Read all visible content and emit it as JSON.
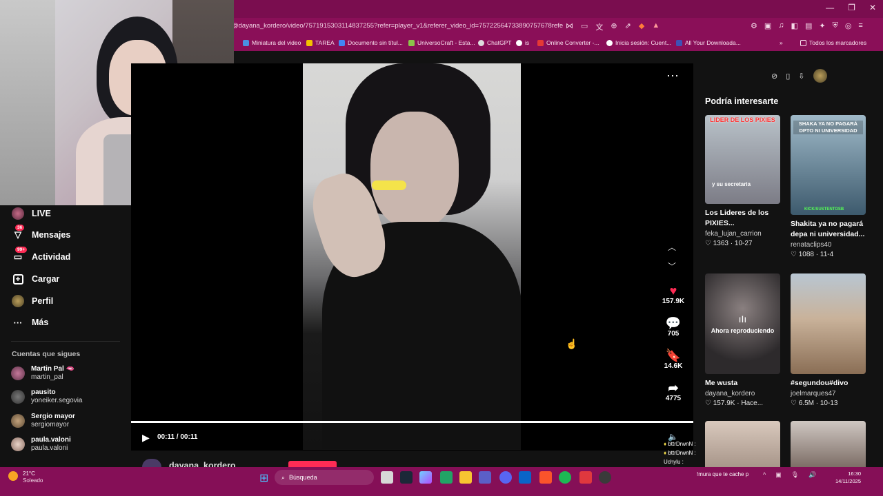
{
  "browser": {
    "url": "@dayana_kordero/video/7571915303114837255?refer=player_v1&referer_video_id=75722564733890757678referre...",
    "bookmarks": [
      "Miniatura del video",
      "TAREA",
      "Documento sin títul...",
      "UniversoCraft - Esta...",
      "ChatGPT",
      "is",
      "Online Converter -...",
      "Inicia sesión: Cuent...",
      "All Your Downloada..."
    ],
    "all_bookmarks": "Todos los marcadores"
  },
  "sidebar": {
    "items": [
      {
        "label": "LIVE",
        "icon": "live-icon"
      },
      {
        "label": "Mensajes",
        "icon": "messages-icon",
        "badge": "36"
      },
      {
        "label": "Actividad",
        "icon": "activity-icon",
        "badge": "99+"
      },
      {
        "label": "Cargar",
        "icon": "upload-icon"
      },
      {
        "label": "Perfil",
        "icon": "profile-icon"
      },
      {
        "label": "Más",
        "icon": "more-icon"
      }
    ],
    "following_title": "Cuentas que sigues",
    "following": [
      {
        "name": "Martin Pal 🫦",
        "handle": "martin_pal"
      },
      {
        "name": "pausito",
        "handle": "yoneiker.segovia"
      },
      {
        "name": "Sergio mayor",
        "handle": "sergiomayor"
      },
      {
        "name": "paula.valoni",
        "handle": "paula.valoni"
      }
    ]
  },
  "player": {
    "time": "00:11 / 00:11",
    "author": "dayana_kordero",
    "actions": {
      "likes": "157.9K",
      "comments": "705",
      "saves": "14.6K",
      "shares": "4775"
    }
  },
  "recommendations": {
    "title": "Podría interesarte",
    "cards": [
      {
        "overlay": "LIDER DE LOS PIXIES",
        "sub": "y su secretaria",
        "title": "Los Lideres de los PIXIES...",
        "user": "feka_lujan_carrion",
        "likes": "1363",
        "date": "10-27"
      },
      {
        "overlay": "SHAKA YA NO PAGARÁ DPTO NI UNIVERSIDAD",
        "sub": "KICK/SUSTENTOSB",
        "title": "Shakita ya no pagará depa ni universidad...",
        "user": "renataclips40",
        "likes": "1088",
        "date": "11-4"
      },
      {
        "overlay": "Ahora reproduciendo",
        "title": "Me wusta",
        "user": "dayana_kordero",
        "likes": "157.9K",
        "date": "Hace..."
      },
      {
        "overlay": "",
        "title": "#segundou#divo",
        "user": "joelmarques47",
        "likes": "6.5M",
        "date": "10-13"
      }
    ]
  },
  "chat": [
    {
      "user": "bttrDrwnN :",
      "msg": ""
    },
    {
      "user": "bttrDrwnN :",
      "msg": ""
    },
    {
      "user": "Uchylu :",
      "msg": ""
    },
    {
      "user": "",
      "msg": "!mura que te cache p"
    }
  ],
  "taskbar": {
    "temp": "21°C",
    "weather": "Soleado",
    "search": "Búsqueda",
    "time": "16:30",
    "date": "14/11/2025"
  },
  "colors": {
    "accent": "#fe2c55",
    "chrome": "#8a0f58",
    "taskbar": "#850f57"
  }
}
